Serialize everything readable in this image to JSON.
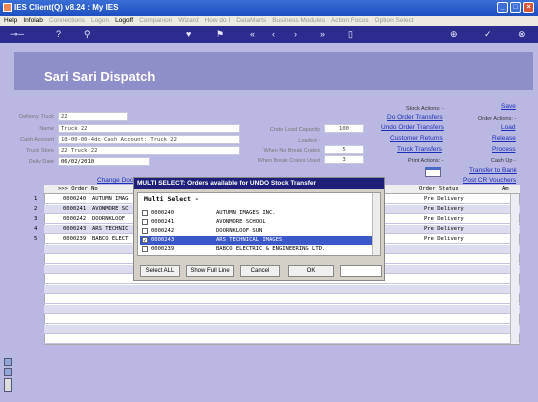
{
  "window": {
    "title": "IES Client(Q) v8.24 : My IES",
    "controls": [
      "_",
      "□",
      "×"
    ]
  },
  "menu": [
    {
      "label": "Help",
      "enabled": true
    },
    {
      "label": "Infolab",
      "enabled": true
    },
    {
      "label": "Connections",
      "enabled": false
    },
    {
      "label": "Logon",
      "enabled": false
    },
    {
      "label": "Logoff",
      "enabled": true
    },
    {
      "label": "Companion",
      "enabled": false
    },
    {
      "label": "Wizard",
      "enabled": false
    },
    {
      "label": "How do I",
      "enabled": false
    },
    {
      "label": "DataMarts",
      "enabled": false
    },
    {
      "label": "Business Modules",
      "enabled": false
    },
    {
      "label": "Action Focus",
      "enabled": false
    },
    {
      "label": "Option Select",
      "enabled": false
    }
  ],
  "toolbar_icons": [
    "key-icon",
    "help-icon",
    "search-icon",
    "heart-icon",
    "flag-icon",
    "rewind-icon",
    "back-icon",
    "forward-icon",
    "fast-forward-icon",
    "trash-icon",
    "add-icon",
    "ok-icon",
    "cancel-icon"
  ],
  "page": {
    "title": "Sari Sari Dispatch"
  },
  "form": {
    "delivery_truck": {
      "label": "Delivery Truck",
      "value": "22"
    },
    "name": {
      "label": "Name",
      "value": "Truck 22"
    },
    "cash_account": {
      "label": "Cash Account",
      "value": "10-00-00-4dc Cash Account: Truck 22"
    },
    "truck_store": {
      "label": "Truck Store",
      "value": "22 Truck 22"
    },
    "deliv_date": {
      "label": "Deliv Date",
      "value": "06/02/2010"
    },
    "crate_load_capacity": {
      "label": "Crate Load Capacity",
      "value": "100"
    },
    "loaded": {
      "label": "Loaded -",
      "value": ""
    },
    "when_no_break_crates": {
      "label": "When No Break Crates",
      "value": "5"
    },
    "when_break_crates_used": {
      "label": "When Break Crates Used",
      "value": "3"
    }
  },
  "actions": {
    "stock_header": "Stock Actions: -",
    "order_transfers": "Do Order Transfers",
    "undo_order_transfers": "Undo Order Transfers",
    "customer_returns": "Customer Returns",
    "truck_transfers": "Truck Transfers",
    "print_header": "Print Actions: -",
    "save": "Save",
    "order_header": "Order Actions: -",
    "load": "Load",
    "release": "Release",
    "process": "Process",
    "cash_header": "Cash Up -",
    "transfer_to_bank": "Transfer to Bank",
    "post_cr_vouchers": "Post CR Vouchers",
    "change_doc": "Change Doc"
  },
  "grid": {
    "columns": [
      ">>> Order No",
      "Order Status",
      "Am"
    ],
    "rows": [
      {
        "num": "1",
        "order": "0000240",
        "customer": "AUTUMN IMAG",
        "status": "Pre Delivery"
      },
      {
        "num": "2",
        "order": "0000241",
        "customer": "AVONMORE SC",
        "status": "Pre Delivery"
      },
      {
        "num": "3",
        "order": "0000242",
        "customer": "DOORNKLOOF",
        "status": "Pre Delivery"
      },
      {
        "num": "4",
        "order": "0000243",
        "customer": "ARS TECHNIC",
        "status": "Pre Delivery"
      },
      {
        "num": "5",
        "order": "0000239",
        "customer": "BABCO ELECT",
        "status": "Pre Delivery"
      }
    ]
  },
  "modal": {
    "title": "MULTI SELECT: Orders available for UNDO Stock Transfer",
    "header": "Multi Select -",
    "items": [
      {
        "code": "0000240",
        "name": "AUTUMN IMAGES INC.",
        "checked": false,
        "selected": false
      },
      {
        "code": "0000241",
        "name": "AVONMORE SCHOOL",
        "checked": false,
        "selected": false
      },
      {
        "code": "0000242",
        "name": "DOORNKLOOF SUN",
        "checked": false,
        "selected": false
      },
      {
        "code": "0000243",
        "name": "ARS TECHNICAL IMAGES",
        "checked": true,
        "selected": true
      },
      {
        "code": "0000239",
        "name": "BABCO ELECTRIC & ENGINEERING LTD.",
        "checked": false,
        "selected": false
      }
    ],
    "buttons": {
      "select_all": "Select ALL",
      "show_full_line": "Show Full Line",
      "cancel": "Cancel",
      "ok": "OK"
    }
  },
  "colors": {
    "titlebar": "#1f4fc0",
    "toolbar": "#2b2c8d",
    "banner": "#8e8ec9",
    "background": "#b9b8e2",
    "selection": "#3a58c7",
    "link": "#1a2eb8"
  }
}
